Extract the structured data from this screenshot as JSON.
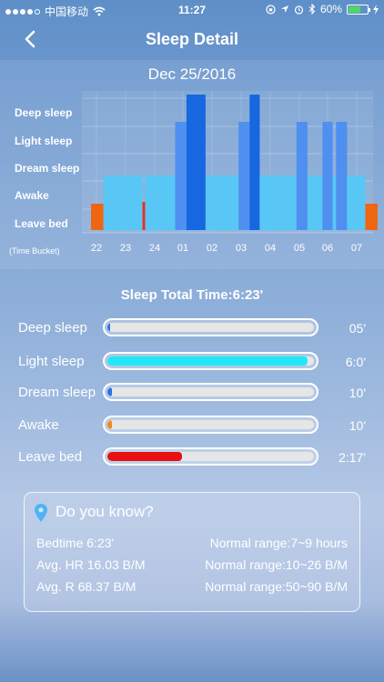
{
  "status_bar": {
    "carrier": "中国移动",
    "time": "11:27",
    "battery": "60%"
  },
  "nav": {
    "title": "Sleep Detail",
    "back_icon": "chevron-left-icon"
  },
  "chart": {
    "date": "Dec 25/2016",
    "y_labels": [
      "Deep sleep",
      "Light sleep",
      "Dream sleep",
      "Awake",
      "Leave bed"
    ],
    "x_labels": [
      "22",
      "23",
      "24",
      "01",
      "02",
      "03",
      "04",
      "05",
      "06",
      "07"
    ],
    "x_axis_note": "(Time Bucket)"
  },
  "chart_data": {
    "type": "bar",
    "x_categories": [
      "22",
      "23",
      "24",
      "01",
      "02",
      "03",
      "04",
      "05",
      "06",
      "07"
    ],
    "y_levels": [
      "Deep sleep",
      "Light sleep",
      "Dream sleep",
      "Awake",
      "Leave bed"
    ],
    "segments": [
      {
        "start": 0.0,
        "end": 0.43,
        "level": "Leave bed",
        "color": "#ee6611"
      },
      {
        "start": 0.43,
        "end": 1.78,
        "level": "Dream sleep",
        "color": "#58c7f5"
      },
      {
        "start": 1.78,
        "end": 1.87,
        "level": "Awake",
        "color": "#e8301e"
      },
      {
        "start": 1.87,
        "end": 2.91,
        "level": "Dream sleep",
        "color": "#58c7f5"
      },
      {
        "start": 2.91,
        "end": 3.3,
        "level": "Light sleep",
        "color": "#4e8ff0"
      },
      {
        "start": 3.3,
        "end": 3.96,
        "level": "Deep sleep",
        "color": "#1667e0"
      },
      {
        "start": 3.96,
        "end": 5.1,
        "level": "Dream sleep",
        "color": "#58c7f5"
      },
      {
        "start": 5.1,
        "end": 5.48,
        "level": "Light sleep",
        "color": "#4e8ff0"
      },
      {
        "start": 5.48,
        "end": 5.83,
        "level": "Deep sleep",
        "color": "#1667e0"
      },
      {
        "start": 5.83,
        "end": 7.1,
        "level": "Dream sleep",
        "color": "#58c7f5"
      },
      {
        "start": 7.1,
        "end": 7.48,
        "level": "Light sleep",
        "color": "#4e8ff0"
      },
      {
        "start": 7.48,
        "end": 8.0,
        "level": "Dream sleep",
        "color": "#58c7f5"
      },
      {
        "start": 8.0,
        "end": 8.35,
        "level": "Light sleep",
        "color": "#4e8ff0"
      },
      {
        "start": 8.35,
        "end": 8.47,
        "level": "Dream sleep",
        "color": "#58c7f5"
      },
      {
        "start": 8.47,
        "end": 8.85,
        "level": "Light sleep",
        "color": "#4e8ff0"
      },
      {
        "start": 8.85,
        "end": 9.48,
        "level": "Dream sleep",
        "color": "#58c7f5"
      },
      {
        "start": 9.48,
        "end": 9.9,
        "level": "Leave bed",
        "color": "#ee6611"
      }
    ]
  },
  "summary": {
    "total": "Sleep Total Time:6:23'",
    "rows": [
      {
        "label": "Deep sleep",
        "value": "05'",
        "fraction": 0.01,
        "color": "#2f6fe6"
      },
      {
        "label": "Light sleep",
        "value": "6:0'",
        "fraction": 0.97,
        "color": "#22e8f5"
      },
      {
        "label": "Dream sleep",
        "value": "10'",
        "fraction": 0.02,
        "color": "#2f6fe6"
      },
      {
        "label": "Awake",
        "value": "10'",
        "fraction": 0.02,
        "color": "#f08a1c"
      },
      {
        "label": "Leave bed",
        "value": "2:17'",
        "fraction": 0.36,
        "color": "#e81010"
      }
    ]
  },
  "info": {
    "heading": "Do you know?",
    "icon": "location-pin-icon",
    "rows": [
      {
        "left": "Bedtime 6:23'",
        "right": "Normal range:7~9 hours"
      },
      {
        "left": "Avg. HR 16.03 B/M",
        "right": "Normal range:10~26 B/M"
      },
      {
        "left": "Avg. R 68.37 B/M",
        "right": "Normal range:50~90 B/M"
      }
    ]
  }
}
